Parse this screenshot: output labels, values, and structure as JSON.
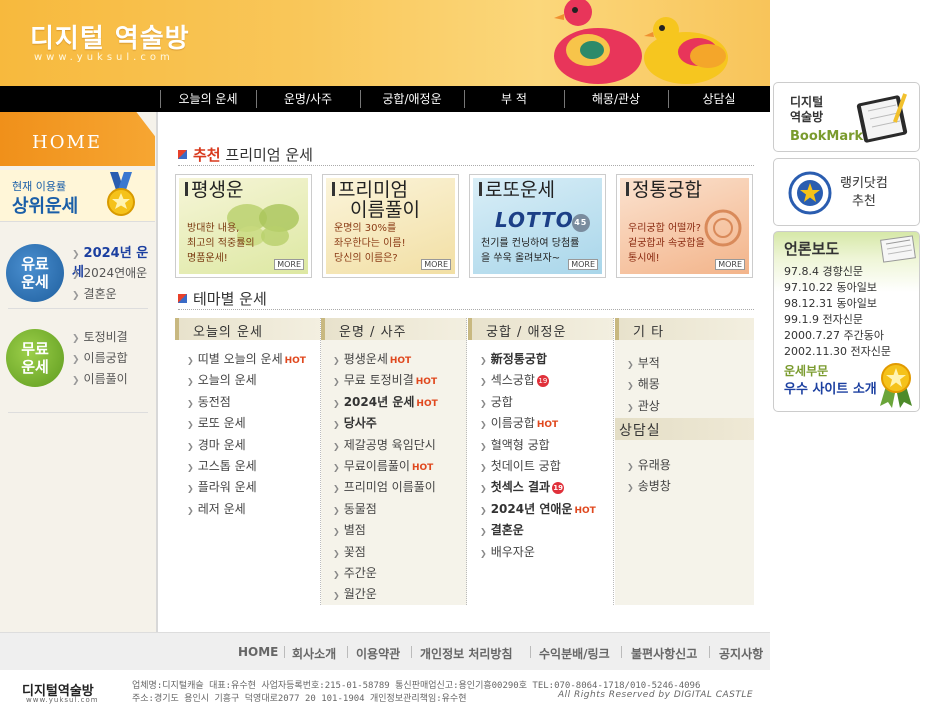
{
  "header": {
    "logo_title": "디지털 역술방",
    "logo_url": "www.yuksul.com"
  },
  "nav": {
    "items": [
      "오늘의 운세",
      "운명/사주",
      "궁합/애정운",
      "부 적",
      "해몽/관상",
      "상담실"
    ]
  },
  "left": {
    "home": "HOME",
    "rank_small": "현재 이용률",
    "rank_big": "상위운세",
    "paid_badge": [
      "유료",
      "운세"
    ],
    "paid_links": [
      "2024년 운세",
      "2024연애운",
      "결혼운"
    ],
    "free_badge": [
      "무료",
      "운세"
    ],
    "free_links": [
      "토정비결",
      "이름궁합",
      "이름풀이"
    ]
  },
  "recommend": {
    "title_accent": "추천",
    "title_rest": "프리미엄 운세",
    "more": "MORE",
    "promos": [
      {
        "title": "평생운",
        "desc": [
          "방대한 내용,",
          "최고의 적중률의",
          "명품운세!"
        ]
      },
      {
        "title": "프리미엄",
        "title2": "이름풀이",
        "desc": [
          "운명의 30%를",
          "좌우한다는 이름!",
          "당신의 이름은?"
        ]
      },
      {
        "title": "로또운세",
        "logo": "LOTTO",
        "logo_num": "45",
        "desc": [
          "천기를 컨닝하여 당첨률",
          "을 쑤욱 올려보자~"
        ]
      },
      {
        "title": "정통궁합",
        "desc": [
          "우리궁합 어떨까?",
          "겉궁합과 속궁합을",
          "통시에!"
        ]
      }
    ]
  },
  "theme": {
    "title": "테마별 운세",
    "hot": "HOT",
    "badge19": "19",
    "col1": {
      "head": "오늘의 운세",
      "items": [
        "띠별 오늘의 운세",
        "오늘의 운세",
        "동전점",
        "로또 운세",
        "경마 운세",
        "고스톱 운세",
        "플라워 운세",
        "레저 운세"
      ]
    },
    "col2": {
      "head": "운명 / 사주",
      "items": [
        "평생운세",
        "무료 토정비결",
        "2024년 운세",
        "당사주",
        "제갈공명 육임단시",
        "무료이름풀이",
        "프리미엄 이름풀이",
        "동물점",
        "별점",
        "꽃점",
        "주간운",
        "월간운"
      ]
    },
    "col3": {
      "head": "궁합 / 애정운",
      "items": [
        "新정통궁합",
        "섹스궁합",
        "궁합",
        "이름궁합",
        "혈액형 궁합",
        "첫데이트 궁합",
        "첫섹스 결과",
        "2024년 연애운",
        "결혼운",
        "배우자운"
      ]
    },
    "col4": {
      "head": "기 타",
      "items": [
        "부적",
        "해몽",
        "관상"
      ],
      "head2": "상담실",
      "items2": [
        "유래용",
        "송병창"
      ]
    }
  },
  "right": {
    "bookmark_l1": "디지털",
    "bookmark_l2": "역술방",
    "bookmark_en": "BookMark",
    "ranking_l1": "랭키닷컴",
    "ranking_l2": "추천",
    "press_title": "언론보도",
    "press": [
      "97.8.4 경향신문",
      "97.10.22 동아일보",
      "98.12.31 동아일보",
      "99.1.9 전자신문",
      "2000.7.27 주간동아",
      "2002.11.30 전자신문"
    ],
    "award_l1": "운세부문",
    "award_l2": "우수 사이트 소개"
  },
  "footer": {
    "links": [
      "HOME",
      "회사소개",
      "이용약관",
      "개인정보 처리방침",
      "수익분배/링크",
      "불편사항신고",
      "공지사항"
    ],
    "logo": "디지털역술방",
    "logo_url": "www.yuksul.com",
    "line1": "업체명:디지털캐슬 대표:유수현 사업자등록번호:215-01-58789 통신판매업신고:용인기흥00290호 TEL:070-8064-1718/010-5246-4096",
    "line2": "주소:경기도 용인시 기흥구 덕영대로2077 20 101-1904  개인정보관리책임:유수현",
    "copyright": "All Rights Reserved by DIGITAL CASTLE"
  }
}
